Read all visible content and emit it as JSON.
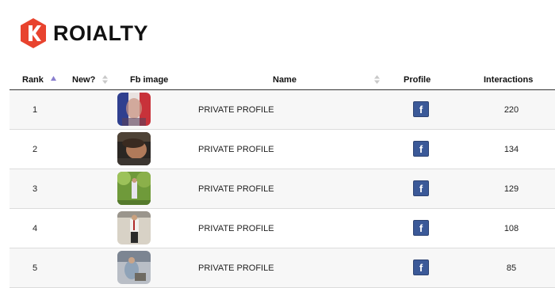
{
  "brand": {
    "name": "ROIALTY"
  },
  "colors": {
    "brand_red": "#e8432e",
    "facebook_blue": "#3b5998",
    "sort_active": "#8a7fcf"
  },
  "columns": {
    "rank": "Rank",
    "new": "New?",
    "fb_image": "Fb image",
    "name": "Name",
    "profile": "Profile",
    "interactions": "Interactions"
  },
  "rows": [
    {
      "rank": "1",
      "name": "PRIVATE PROFILE",
      "profile_icon": "f",
      "interactions": "220"
    },
    {
      "rank": "2",
      "name": "PRIVATE PROFILE",
      "profile_icon": "f",
      "interactions": "134"
    },
    {
      "rank": "3",
      "name": "PRIVATE PROFILE",
      "profile_icon": "f",
      "interactions": "129"
    },
    {
      "rank": "4",
      "name": "PRIVATE PROFILE",
      "profile_icon": "f",
      "interactions": "108"
    },
    {
      "rank": "5",
      "name": "PRIVATE PROFILE",
      "profile_icon": "f",
      "interactions": "85"
    }
  ]
}
